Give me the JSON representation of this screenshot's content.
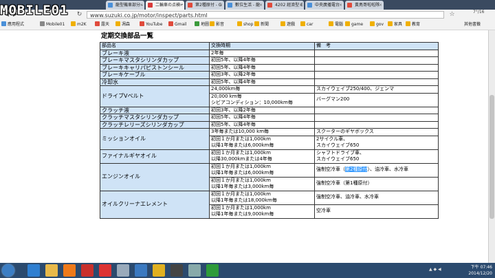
{
  "browser": {
    "tabs": [
      {
        "label": "龍型機車部分 - ",
        "fav": "#4a90d9",
        "active": false
      },
      {
        "label": "二輪車の点検・",
        "fav": "#d93a3a",
        "active": true
      },
      {
        "label": "第2種原付 - G",
        "fav": "#e04b3c",
        "active": false
      },
      {
        "label": "數位生活 - 龍",
        "fav": "#4a90d9",
        "active": false
      },
      {
        "label": "4202 經濟型 E",
        "fav": "#e04b3c",
        "active": false
      },
      {
        "label": "中央廣播電台",
        "fav": "#4a90d9",
        "active": false
      },
      {
        "label": "黃鳥哥啦啦隊",
        "fav": "#e04b3c",
        "active": false
      }
    ],
    "url": "www.suzuki.co.jp/motor/inspect/parts.html",
    "weather": "7°/16",
    "bookmarks": [
      {
        "label": "應用程式",
        "color": "#4a90d9"
      },
      {
        "label": "Mobile01",
        "color": "#888"
      },
      {
        "label": "m2K",
        "color": "#f0b000"
      },
      {
        "label": "露天",
        "color": "#e04b3c"
      },
      {
        "label": "凋森",
        "color": "#f0b000"
      },
      {
        "label": "YouTube",
        "color": "#e04b3c"
      },
      {
        "label": "Gmail",
        "color": "#e04b3c"
      },
      {
        "label": "地圖",
        "color": "#3b9a3b"
      },
      {
        "label": "影音",
        "color": "#f0b000"
      },
      {
        "label": "shop",
        "color": "#f0b000"
      },
      {
        "label": "新聞",
        "color": "#f0b000"
      },
      {
        "label": "遊戲",
        "color": "#f0b000"
      },
      {
        "label": "car",
        "color": "#f0b000"
      },
      {
        "label": "電腦",
        "color": "#f0b000"
      },
      {
        "label": "game",
        "color": "#f0b000"
      },
      {
        "label": "gov",
        "color": "#f0b000"
      },
      {
        "label": "家具",
        "color": "#f0b000"
      },
      {
        "label": "教育",
        "color": "#f0b000"
      }
    ],
    "other_bookmarks": "其他書籤"
  },
  "logo": "MOBILE01",
  "page": {
    "title": "定期交換部品一覧",
    "headers": [
      "部品名",
      "交換時期",
      "備　考"
    ],
    "rows": [
      {
        "part": "ブレーキ液",
        "cells": [
          [
            "2年毎",
            ""
          ]
        ]
      },
      {
        "part": "ブレーキマスタシリンダカップ",
        "cells": [
          [
            "初回5年、以降4年毎",
            ""
          ]
        ]
      },
      {
        "part": "ブレーキキャリパピストンシール",
        "cells": [
          [
            "初回5年、以降4年毎",
            ""
          ]
        ]
      },
      {
        "part": "ブレーキケーブル",
        "cells": [
          [
            "初回3年、以降2年毎",
            ""
          ]
        ]
      },
      {
        "part": "冷却水",
        "cells": [
          [
            "初回5年、以降4年毎",
            ""
          ]
        ]
      },
      {
        "part": "ドライブVベルト",
        "cells": [
          [
            "24,000km毎",
            "スカイウェイブ250/400、ジェンマ"
          ],
          [
            "20,000 km毎\nシビアコンディション：10,000km毎",
            "バーグマン200"
          ]
        ]
      },
      {
        "part": "クラッチ液",
        "cells": [
          [
            "初回3年、以降2年毎",
            ""
          ]
        ]
      },
      {
        "part": "クラッチマスタシリンダカップ",
        "cells": [
          [
            "初回5年、以降4年毎",
            ""
          ]
        ]
      },
      {
        "part": "クラッチレリーズシリンダカップ",
        "cells": [
          [
            "初回5年、以降4年毎",
            ""
          ]
        ]
      },
      {
        "part": "ミッションオイル",
        "cells": [
          [
            "3年毎または10,000 km毎",
            "スクーターのギヤボックス"
          ],
          [
            "初回１か月または1,000km\n以降1年毎または6,000km毎",
            "2サイクル車、\nスカイウェイブ650"
          ]
        ]
      },
      {
        "part": "ファイナルギヤオイル",
        "cells": [
          [
            "初回１か月または1,000km\n以降30,000kmまたは4年毎",
            "シャフトドライブ車、\nスカイウェイブ650"
          ]
        ]
      },
      {
        "part": "エンジンオイル",
        "cells": [
          [
            "初回１か月または1,000km\n以降1年毎または6,000km毎",
            "強制空冷車（第2種原付）、油冷車、水冷車"
          ],
          [
            "初回１か月または1,000km\n以降1年毎または3,000km毎",
            "強制空冷車（第1種原付）"
          ]
        ]
      },
      {
        "part": "オイルクリーナエレメント",
        "cells": [
          [
            "初回１か月または1,000km\n以降1年毎または18,000km毎",
            "強制空冷車、油冷車、水冷車"
          ],
          [
            "初回１か月または1,000km\n以降1年毎または9,000km毎",
            "空冷車"
          ]
        ]
      }
    ],
    "highlight": "第2種原付"
  },
  "taskbar": {
    "icons": [
      {
        "name": "ie-icon",
        "color": "#2f7fd1"
      },
      {
        "name": "explorer-icon",
        "color": "#e8b94a"
      },
      {
        "name": "media-player-icon",
        "color": "#ef7a1a"
      },
      {
        "name": "pinned-app-icon",
        "color": "#c9302c"
      },
      {
        "name": "app-red-icon",
        "color": "#d33"
      },
      {
        "name": "tools-icon",
        "color": "#9ab"
      },
      {
        "name": "app-blue-icon",
        "color": "#3a79c0"
      },
      {
        "name": "chrome-icon",
        "color": "#e0b020"
      },
      {
        "name": "app-dark-icon",
        "color": "#444"
      },
      {
        "name": "calculator-icon",
        "color": "#8aa"
      },
      {
        "name": "app-green-icon",
        "color": "#2e9b3a"
      }
    ],
    "time": "下午 07:46",
    "date": "2014/12/20",
    "tray": "▲ ◆ ◀"
  }
}
